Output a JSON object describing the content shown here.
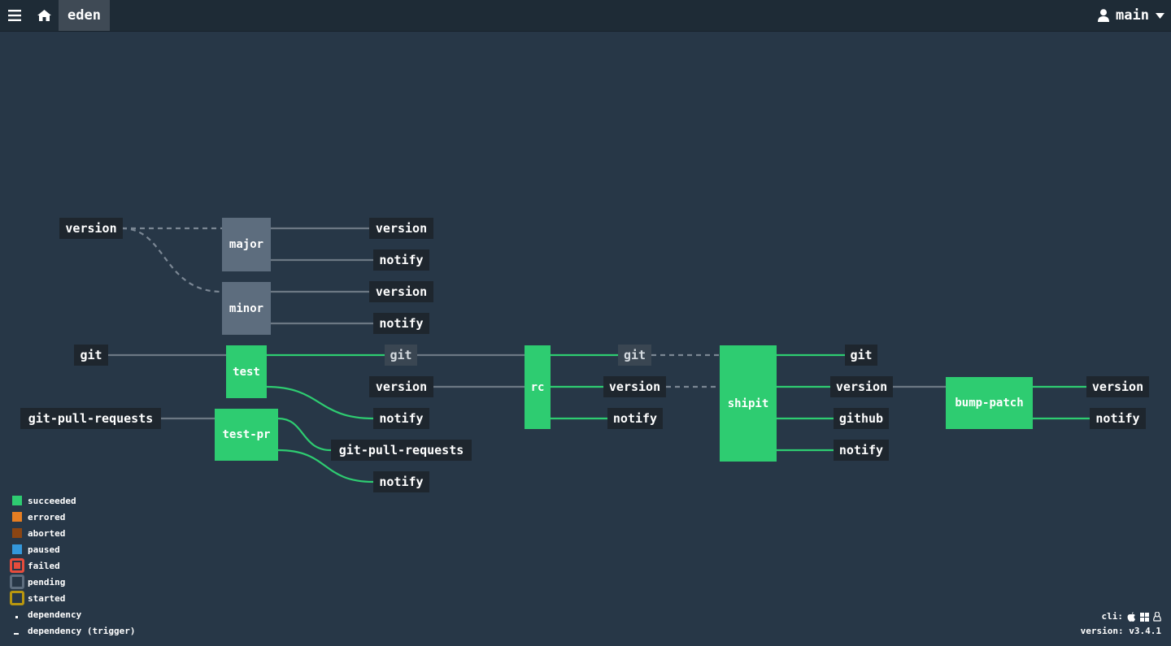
{
  "topbar": {
    "pipeline": "eden",
    "user": "main"
  },
  "nodes": {
    "res_version_in": "version",
    "job_major": "major",
    "job_minor": "minor",
    "major_version": "version",
    "major_notify": "notify",
    "minor_version": "version",
    "minor_notify": "notify",
    "res_git_in": "git",
    "job_test": "test",
    "test_git": "git",
    "test_version": "version",
    "test_notify": "notify",
    "res_gpr_in": "git-pull-requests",
    "job_testpr": "test-pr",
    "testpr_gpr": "git-pull-requests",
    "testpr_notify": "notify",
    "job_rc": "rc",
    "rc_git": "git",
    "rc_version": "version",
    "rc_notify": "notify",
    "job_shipit": "shipit",
    "shipit_git": "git",
    "shipit_version": "version",
    "shipit_github": "github",
    "shipit_notify": "notify",
    "job_bump": "bump-patch",
    "bump_version": "version",
    "bump_notify": "notify"
  },
  "legend": {
    "succeeded": "succeeded",
    "errored": "errored",
    "aborted": "aborted",
    "paused": "paused",
    "failed": "failed",
    "pending": "pending",
    "started": "started",
    "dependency": "dependency",
    "dependency_trigger": "dependency (trigger)"
  },
  "colors": {
    "succeeded": "#2ecc71",
    "errored": "#e67e22",
    "aborted": "#8b4513",
    "paused": "#3498db",
    "failed": "#e74c3c",
    "pending": "#5d6d7e",
    "started": "#f1c40f"
  },
  "footer": {
    "cli_label": "cli:",
    "version_label": "version:",
    "version": "v3.4.1"
  }
}
